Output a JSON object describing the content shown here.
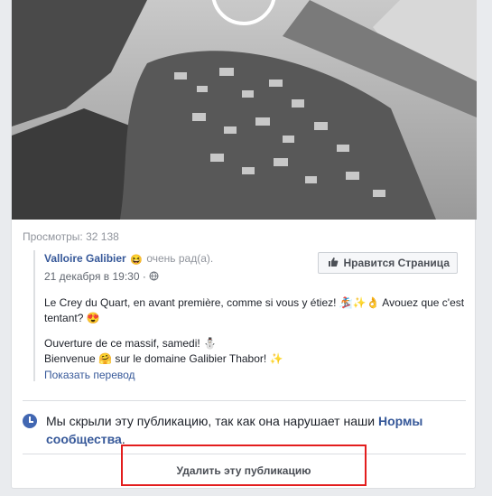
{
  "video": {
    "play_icon": "play-icon"
  },
  "post": {
    "views": "Просмотры: 32 138",
    "shared": {
      "page_name": "Valloire Galibier",
      "feeling_emoji": "😆",
      "feeling_text": "очень рад(а).",
      "date": "21 декабря в 19:30",
      "privacy_icon": "globe-icon",
      "like_page_label": "Нравится Страница",
      "text_line1": "Le Crey du Quart, en avant première, comme si vous y étiez! 🏂✨👌 Avouez que c'est tentant? 😍",
      "text_line2": "Ouverture de ce massif, samedi! ⛄",
      "text_line3_a": "Bienvenue",
      "text_line3_emoji": "🤗",
      "text_line3_b": "sur le domaine Galibier Thabor! ✨",
      "translate_link": "Показать перевод"
    }
  },
  "notice": {
    "icon": "clock-icon",
    "text": "Мы скрыли эту публикацию, так как она нарушает наши",
    "link": "Нормы сообщества",
    "end": "."
  },
  "actions": {
    "delete_label": "Удалить эту публикацию"
  },
  "colors": {
    "link": "#365899",
    "highlight": "#e31d1d",
    "accent": "#4267b2"
  }
}
